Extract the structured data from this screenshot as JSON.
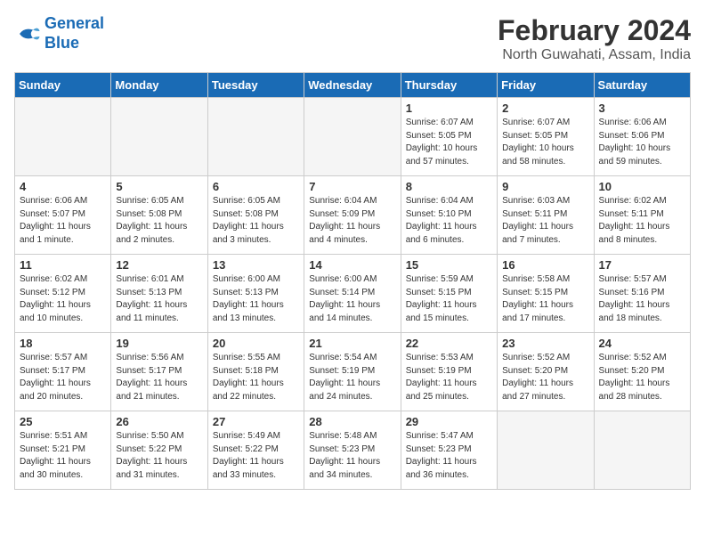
{
  "logo": {
    "line1": "General",
    "line2": "Blue"
  },
  "title": "February 2024",
  "subtitle": "North Guwahati, Assam, India",
  "headers": [
    "Sunday",
    "Monday",
    "Tuesday",
    "Wednesday",
    "Thursday",
    "Friday",
    "Saturday"
  ],
  "weeks": [
    [
      {
        "day": "",
        "info": ""
      },
      {
        "day": "",
        "info": ""
      },
      {
        "day": "",
        "info": ""
      },
      {
        "day": "",
        "info": ""
      },
      {
        "day": "1",
        "info": "Sunrise: 6:07 AM\nSunset: 5:05 PM\nDaylight: 10 hours\nand 57 minutes."
      },
      {
        "day": "2",
        "info": "Sunrise: 6:07 AM\nSunset: 5:05 PM\nDaylight: 10 hours\nand 58 minutes."
      },
      {
        "day": "3",
        "info": "Sunrise: 6:06 AM\nSunset: 5:06 PM\nDaylight: 10 hours\nand 59 minutes."
      }
    ],
    [
      {
        "day": "4",
        "info": "Sunrise: 6:06 AM\nSunset: 5:07 PM\nDaylight: 11 hours\nand 1 minute."
      },
      {
        "day": "5",
        "info": "Sunrise: 6:05 AM\nSunset: 5:08 PM\nDaylight: 11 hours\nand 2 minutes."
      },
      {
        "day": "6",
        "info": "Sunrise: 6:05 AM\nSunset: 5:08 PM\nDaylight: 11 hours\nand 3 minutes."
      },
      {
        "day": "7",
        "info": "Sunrise: 6:04 AM\nSunset: 5:09 PM\nDaylight: 11 hours\nand 4 minutes."
      },
      {
        "day": "8",
        "info": "Sunrise: 6:04 AM\nSunset: 5:10 PM\nDaylight: 11 hours\nand 6 minutes."
      },
      {
        "day": "9",
        "info": "Sunrise: 6:03 AM\nSunset: 5:11 PM\nDaylight: 11 hours\nand 7 minutes."
      },
      {
        "day": "10",
        "info": "Sunrise: 6:02 AM\nSunset: 5:11 PM\nDaylight: 11 hours\nand 8 minutes."
      }
    ],
    [
      {
        "day": "11",
        "info": "Sunrise: 6:02 AM\nSunset: 5:12 PM\nDaylight: 11 hours\nand 10 minutes."
      },
      {
        "day": "12",
        "info": "Sunrise: 6:01 AM\nSunset: 5:13 PM\nDaylight: 11 hours\nand 11 minutes."
      },
      {
        "day": "13",
        "info": "Sunrise: 6:00 AM\nSunset: 5:13 PM\nDaylight: 11 hours\nand 13 minutes."
      },
      {
        "day": "14",
        "info": "Sunrise: 6:00 AM\nSunset: 5:14 PM\nDaylight: 11 hours\nand 14 minutes."
      },
      {
        "day": "15",
        "info": "Sunrise: 5:59 AM\nSunset: 5:15 PM\nDaylight: 11 hours\nand 15 minutes."
      },
      {
        "day": "16",
        "info": "Sunrise: 5:58 AM\nSunset: 5:15 PM\nDaylight: 11 hours\nand 17 minutes."
      },
      {
        "day": "17",
        "info": "Sunrise: 5:57 AM\nSunset: 5:16 PM\nDaylight: 11 hours\nand 18 minutes."
      }
    ],
    [
      {
        "day": "18",
        "info": "Sunrise: 5:57 AM\nSunset: 5:17 PM\nDaylight: 11 hours\nand 20 minutes."
      },
      {
        "day": "19",
        "info": "Sunrise: 5:56 AM\nSunset: 5:17 PM\nDaylight: 11 hours\nand 21 minutes."
      },
      {
        "day": "20",
        "info": "Sunrise: 5:55 AM\nSunset: 5:18 PM\nDaylight: 11 hours\nand 22 minutes."
      },
      {
        "day": "21",
        "info": "Sunrise: 5:54 AM\nSunset: 5:19 PM\nDaylight: 11 hours\nand 24 minutes."
      },
      {
        "day": "22",
        "info": "Sunrise: 5:53 AM\nSunset: 5:19 PM\nDaylight: 11 hours\nand 25 minutes."
      },
      {
        "day": "23",
        "info": "Sunrise: 5:52 AM\nSunset: 5:20 PM\nDaylight: 11 hours\nand 27 minutes."
      },
      {
        "day": "24",
        "info": "Sunrise: 5:52 AM\nSunset: 5:20 PM\nDaylight: 11 hours\nand 28 minutes."
      }
    ],
    [
      {
        "day": "25",
        "info": "Sunrise: 5:51 AM\nSunset: 5:21 PM\nDaylight: 11 hours\nand 30 minutes."
      },
      {
        "day": "26",
        "info": "Sunrise: 5:50 AM\nSunset: 5:22 PM\nDaylight: 11 hours\nand 31 minutes."
      },
      {
        "day": "27",
        "info": "Sunrise: 5:49 AM\nSunset: 5:22 PM\nDaylight: 11 hours\nand 33 minutes."
      },
      {
        "day": "28",
        "info": "Sunrise: 5:48 AM\nSunset: 5:23 PM\nDaylight: 11 hours\nand 34 minutes."
      },
      {
        "day": "29",
        "info": "Sunrise: 5:47 AM\nSunset: 5:23 PM\nDaylight: 11 hours\nand 36 minutes."
      },
      {
        "day": "",
        "info": ""
      },
      {
        "day": "",
        "info": ""
      }
    ]
  ]
}
